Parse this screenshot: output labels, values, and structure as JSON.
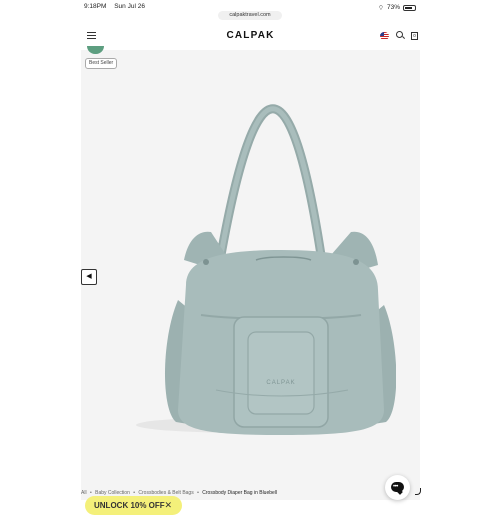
{
  "status_bar": {
    "time": "9:18PM",
    "date": "Sun Jul 26",
    "battery": "73%"
  },
  "browser": {
    "url": "calpaktravel.com"
  },
  "header": {
    "logo": "CALPAK",
    "cart_count": "0"
  },
  "product": {
    "badge": "Best Seller",
    "image_alt": "Crossbody Diaper Bag in Bluebell",
    "bag_brand_mark": "CALPAK",
    "prev_arrow": "◀",
    "colors": {
      "bag": "#a8bcbb",
      "bag_shadow": "#8ea3a2",
      "background": "#f4f4f4"
    }
  },
  "promo": {
    "label": "UNLOCK 10% OFF",
    "close": "✕",
    "color": "#f4f07a"
  },
  "breadcrumb": {
    "items": [
      "All",
      "Baby Collection",
      "Crossbodies & Belt Bags"
    ],
    "separator": "•",
    "current": "Crossbody Diaper Bag in Bluebell"
  }
}
